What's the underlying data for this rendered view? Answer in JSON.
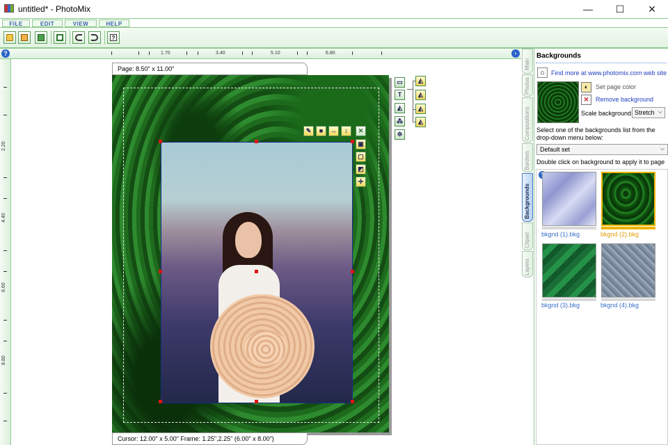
{
  "window": {
    "title": "untitled* - PhotoMix",
    "minimize": "—",
    "maximize": "☐",
    "close": "✕"
  },
  "menu": [
    "FILE",
    "EDIT",
    "VIEW",
    "HELP"
  ],
  "ruler": {
    "h_labels": [
      "1.70",
      "3.40",
      "5.10",
      "6.80"
    ],
    "v_labels": [
      "2.20",
      "4.40",
      "6.60",
      "8.80"
    ],
    "help": "?"
  },
  "canvas": {
    "page_size": "Page: 8.50\" x 11.00\"",
    "status": "Cursor: 12.00\" x 5.00\"  Frame: 1.25\",2.25\" (6.00\" x 8.00\")"
  },
  "side_tabs": [
    "Main",
    "Photos",
    "Compositions",
    "Borders",
    "Backgrounds",
    "Clipart",
    "Layers"
  ],
  "active_tab": "Backgrounds",
  "panel": {
    "title": "Backgrounds",
    "web_link": "Find more at www.photomix.com web site",
    "set_page_color": "Set page color",
    "remove_background": "Remove background",
    "scale_label": "Scale background:",
    "scale_value": "Stretch",
    "instruction_1": "Select one of the backgrounds list from the drop-down menu below:",
    "set_value": "Default set",
    "instruction_2": "Double click on background to apply it to page",
    "thumbnails": [
      {
        "caption": "bkgnd (1).bkg",
        "selected": false,
        "color": "#aeb6dc"
      },
      {
        "caption": "bkgnd (2).bkg",
        "selected": true,
        "color": "#1d6b1d"
      },
      {
        "caption": "bkgnd (3).bkg",
        "selected": false,
        "color": "#1e7a3a"
      },
      {
        "caption": "bkgnd (4).bkg",
        "selected": false,
        "color": "#8494a6"
      }
    ]
  },
  "colors": {
    "accent_green": "#8fc98f",
    "link_blue": "#1f3fbf",
    "handle_red": "#e31313",
    "selection_orange": "#f0b400"
  }
}
